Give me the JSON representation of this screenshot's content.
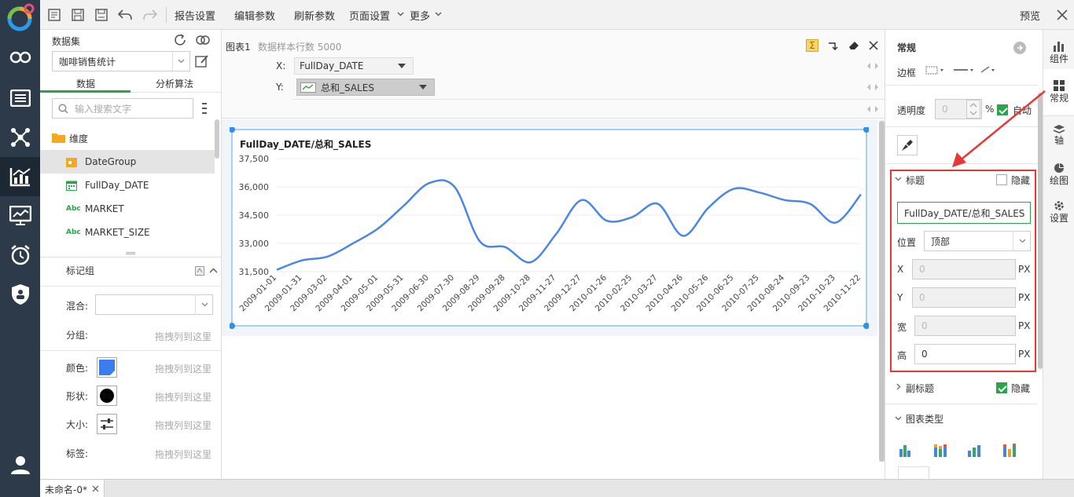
{
  "toolbar": {
    "report_settings": "报告设置",
    "edit_params": "编辑参数",
    "refresh_params": "刷新参数",
    "page_settings": "页面设置",
    "more": "更多",
    "preview": "预览"
  },
  "dataset": {
    "title": "数据集",
    "selected": "咖啡销售统计",
    "tab_data": "数据",
    "tab_algo": "分析算法",
    "search_placeholder": "输入搜索文字",
    "dimension_label": "维度",
    "fields": [
      "DateGroup",
      "FullDay_DATE",
      "MARKET",
      "MARKET_SIZE"
    ],
    "abc": "Abc"
  },
  "marks": {
    "title": "标记组",
    "mix_label": "混合:",
    "group_label": "分组:",
    "color_label": "颜色:",
    "shape_label": "形状:",
    "size_label": "大小:",
    "tag_label": "标签:",
    "drop_hint": "拖拽列到这里",
    "colors": {
      "color_swatch": "#3b7ded"
    }
  },
  "chart_panel": {
    "name": "图表1",
    "sample_rows": "数据样本行数 5000",
    "x_label": "X:",
    "x_field": "FullDay_DATE",
    "y_label": "Y:",
    "y_field": "总和_SALES"
  },
  "chart_data": {
    "type": "line",
    "title": "FullDay_DATE/总和_SALES",
    "xlabel": "",
    "ylabel": "",
    "ylim": [
      31500,
      37500
    ],
    "yticks": [
      "37,500",
      "36,000",
      "34,500",
      "33,000",
      "31,500"
    ],
    "ytick_values": [
      37500,
      36000,
      34500,
      33000,
      31500
    ],
    "categories": [
      "2009-01-01",
      "2009-01-31",
      "2009-03-02",
      "2009-04-01",
      "2009-05-01",
      "2009-05-31",
      "2009-06-30",
      "2009-07-30",
      "2009-08-29",
      "2009-09-28",
      "2009-10-28",
      "2009-11-27",
      "2009-12-27",
      "2010-01-26",
      "2010-02-25",
      "2010-03-27",
      "2010-04-26",
      "2010-05-26",
      "2010-06-25",
      "2010-07-25",
      "2010-08-24",
      "2010-09-23",
      "2010-10-23",
      "2010-11-22"
    ],
    "series": [
      {
        "values": [
          31600,
          32100,
          32300,
          33000,
          33800,
          35000,
          36200,
          36000,
          33100,
          32800,
          32000,
          33500,
          35300,
          34200,
          34400,
          35100,
          33400,
          34900,
          35900,
          35700,
          35300,
          35100,
          34100,
          35600
        ],
        "color": "#4a86e8"
      }
    ]
  },
  "right_panel": {
    "section_title": "常规",
    "border_label": "边框",
    "opacity_label": "透明度",
    "opacity_value": "0",
    "percent": "%",
    "auto_label": "自动",
    "title_section": "标题",
    "hide_label": "隐藏",
    "title_value": "FullDay_DATE/总和_SALES",
    "position_label": "位置",
    "position_value": "顶部",
    "x_label": "X",
    "y_label": "Y",
    "width_label": "宽",
    "height_label": "高",
    "x_value": "0",
    "y_value": "0",
    "w_value": "0",
    "h_value": "0",
    "px": "PX",
    "subtitle_section": "副标题",
    "subtitle_hide": "隐藏",
    "chart_type_section": "图表类型"
  },
  "right_tabs": [
    "组件",
    "常规",
    "轴",
    "绘图",
    "设置"
  ],
  "bottom_tab": "未命名-0*"
}
